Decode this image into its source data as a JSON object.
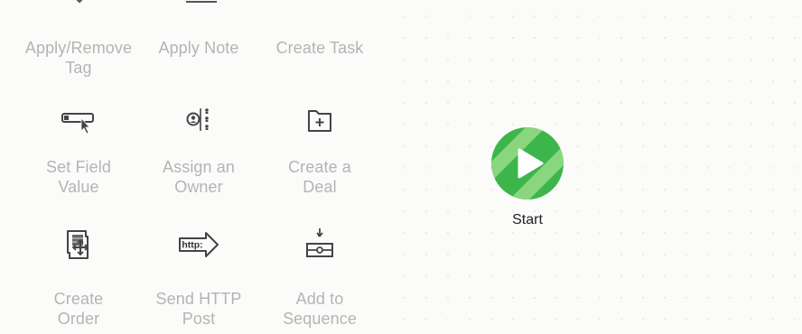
{
  "palette": {
    "row1": [
      {
        "id": "apply-remove-tag",
        "label_line1": "Apply/Remove",
        "label_line2": "Tag",
        "icon": "tag-icon"
      },
      {
        "id": "apply-note",
        "label_line1": "Apply Note",
        "label_line2": "",
        "icon": "note-icon"
      },
      {
        "id": "create-task",
        "label_line1": "Create Task",
        "label_line2": "",
        "icon": "task-icon"
      }
    ],
    "row2": [
      {
        "id": "set-field-value",
        "label_line1": "Set Field",
        "label_line2": "Value",
        "icon": "field-cursor-icon"
      },
      {
        "id": "assign-owner",
        "label_line1": "Assign an",
        "label_line2": "Owner",
        "icon": "assign-owner-icon"
      },
      {
        "id": "create-deal",
        "label_line1": "Create a",
        "label_line2": "Deal",
        "icon": "folder-plus-icon"
      }
    ],
    "row3": [
      {
        "id": "create-order",
        "label_line1": "Create",
        "label_line2": "Order",
        "icon": "order-document-icon"
      },
      {
        "id": "send-http-post",
        "label_line1": "Send HTTP",
        "label_line2": "Post",
        "icon": "http-arrow-icon",
        "icon_text": "http:"
      },
      {
        "id": "add-to-sequence",
        "label_line1": "Add to",
        "label_line2": "Sequence",
        "icon": "sequence-icon"
      }
    ]
  },
  "start_node": {
    "label": "Start",
    "icon": "play-icon",
    "color_primary": "#3cb64b",
    "color_light": "#8ad67f"
  },
  "colors": {
    "label_gray": "#b4b4b4",
    "icon_dark": "#444444",
    "background": "#fbfbfa"
  }
}
